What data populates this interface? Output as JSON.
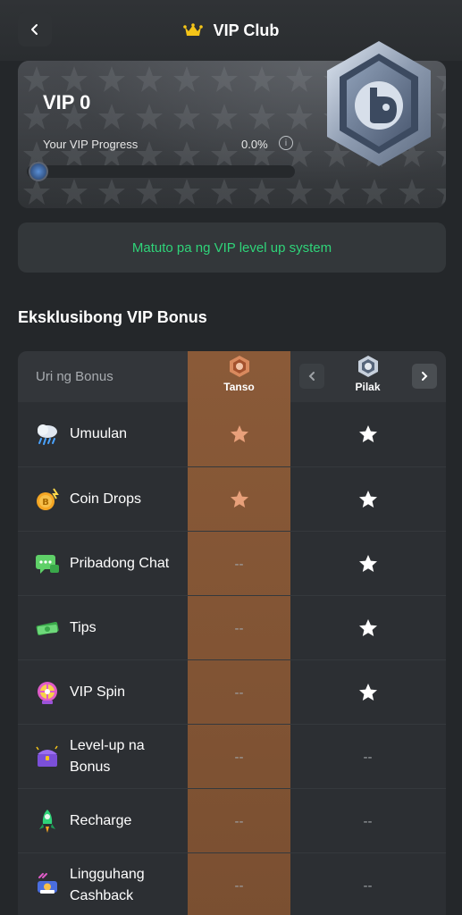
{
  "header": {
    "title": "VIP Club"
  },
  "vip_card": {
    "level": "VIP 0",
    "progress_label": "Your VIP Progress",
    "progress_value": "0.0%",
    "progress_fraction": 0.0
  },
  "learn_button": {
    "label": "Matuto pa ng VIP level up system"
  },
  "bonus_section": {
    "title": "Eksklusibong VIP Bonus"
  },
  "table": {
    "header_label": "Uri ng Bonus",
    "tiers": [
      {
        "name": "Tanso",
        "color": "#c9744a"
      },
      {
        "name": "Pilak",
        "color": "#9aa6b8"
      }
    ],
    "rows": [
      {
        "label": "Umuulan",
        "icon": "rain-cloud-icon",
        "tanso": "star",
        "pilak": "star"
      },
      {
        "label": "Coin Drops",
        "icon": "coin-icon",
        "tanso": "star",
        "pilak": "star"
      },
      {
        "label": "Pribadong Chat",
        "icon": "chat-icon",
        "tanso": "--",
        "pilak": "star"
      },
      {
        "label": "Tips",
        "icon": "money-icon",
        "tanso": "--",
        "pilak": "star"
      },
      {
        "label": "VIP Spin",
        "icon": "spin-wheel-icon",
        "tanso": "--",
        "pilak": "star"
      },
      {
        "label": "Level-up na Bonus",
        "icon": "treasure-chest-icon",
        "tanso": "--",
        "pilak": "--"
      },
      {
        "label": "Recharge",
        "icon": "rocket-icon",
        "tanso": "--",
        "pilak": "--"
      },
      {
        "label": "Lingguhang Cashback",
        "icon": "cashback-icon",
        "tanso": "--",
        "pilak": "--"
      }
    ]
  },
  "colors": {
    "accent_green": "#2fd479",
    "tanso_star": "#e8a07a",
    "pilak_star": "#ffffff",
    "crown": "#f5c518"
  }
}
